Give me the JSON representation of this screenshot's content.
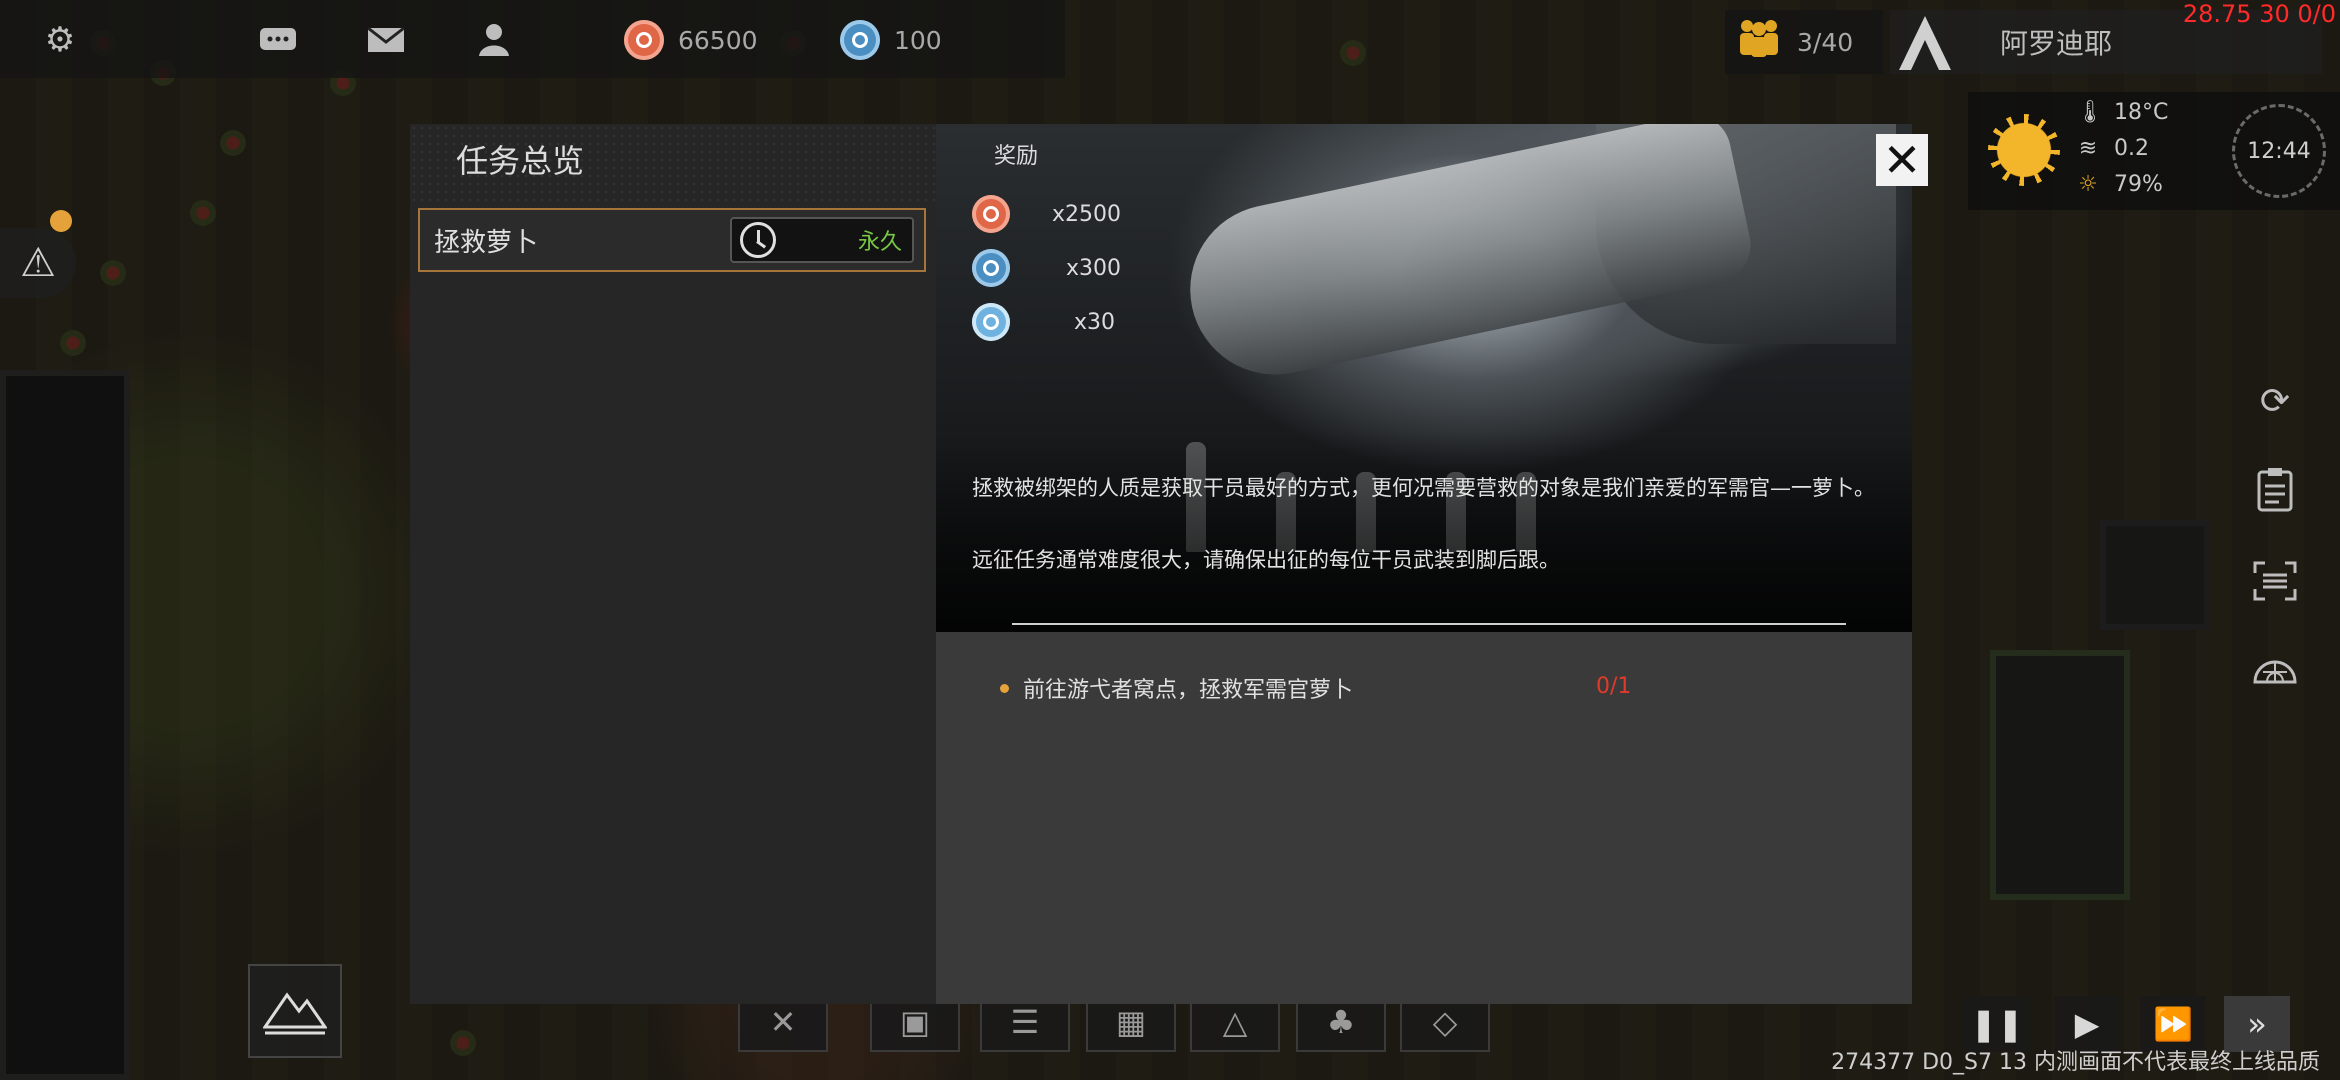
{
  "topbar": {
    "settings_icon": "gear-icon",
    "chat_icon": "chat-icon",
    "mail_icon": "mail-icon",
    "profile_icon": "person-icon",
    "resource_red_value": "66500",
    "resource_blue_value": "100"
  },
  "population": {
    "value": "3/40",
    "icon": "people-icon"
  },
  "base": {
    "name": "阿罗迪耶"
  },
  "debug_text": "28.75 30 0/0",
  "weather": {
    "temperature": "18°C",
    "wind": "0.2",
    "humidity": "79%",
    "time": "12:44"
  },
  "quest_panel": {
    "title": "任务总览",
    "quests": [
      {
        "name": "拯救萝卜",
        "duration": "永久"
      }
    ]
  },
  "quest_detail": {
    "rewards_label": "奖励",
    "rewards": [
      {
        "icon": "red-coin-icon",
        "qty": "x2500"
      },
      {
        "icon": "blue-coin-icon",
        "qty": "x300"
      },
      {
        "icon": "light-blue-coin-icon",
        "qty": "x30"
      }
    ],
    "description_1": "拯救被绑架的人质是获取干员最好的方式，更何况需要营救的对象是我们亲爱的军需官—一萝卜。",
    "description_2": "远征任务通常难度很大，请确保出征的每位干员武装到脚后跟。",
    "objectives": [
      {
        "text": "前往游弋者窝点，拯救军需官萝卜",
        "progress": "0/1"
      }
    ],
    "close_label": "✕"
  },
  "footer": {
    "version": "274377 D0_S7 13  内测画面不代表最终上线品质"
  },
  "colors": {
    "accent_orange": "#a5753a",
    "timer_green": "#78c845",
    "progress_red": "#e03a2a",
    "debug_red": "#ff2a2a"
  }
}
